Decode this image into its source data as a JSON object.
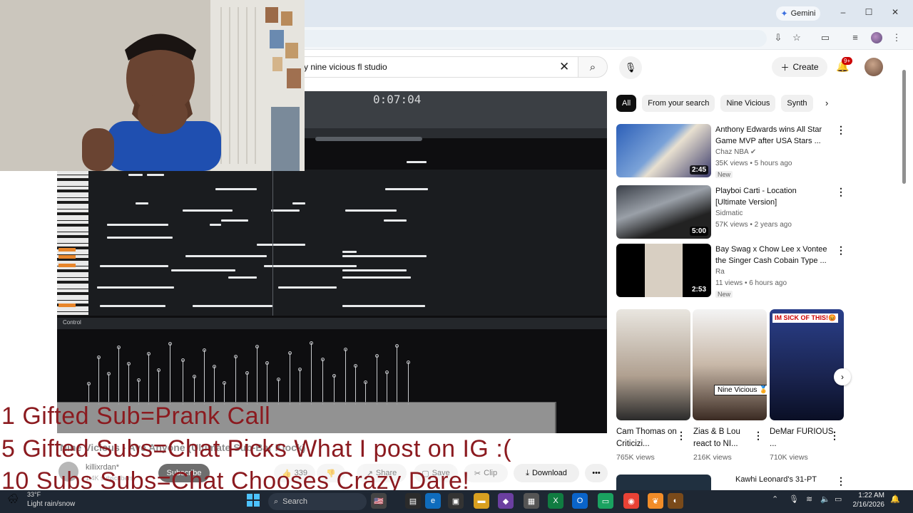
{
  "browser": {
    "gemini_label": "Gemini",
    "window_controls": [
      "–",
      "☐",
      "✕"
    ]
  },
  "youtube": {
    "search_value": "y nine vicious fl studio",
    "create_label": "Create",
    "notif_badge": "9+",
    "chips": [
      "All",
      "From your search",
      "Nine Vicious",
      "Synth"
    ]
  },
  "player": {
    "fl_time": "0:07:04",
    "control_label": "Control"
  },
  "below_player": {
    "video_title": "Nine Vicious - Ave Anyone (Ultimate Sub-Bar Klock)",
    "channel": "killixrdan*",
    "subs": "1.4K subscribers",
    "subscribe": "Subscribe",
    "likes": "339",
    "share": "Share",
    "save": "Save",
    "clip": "Clip",
    "download": "Download"
  },
  "recommendations": [
    {
      "title": "Anthony Edwards wins All Star Game MVP after USA Stars ...",
      "channel": "Chaz NBA",
      "meta": "35K views • 5 hours ago",
      "duration": "2:45",
      "badge": "New"
    },
    {
      "title": "Playboi Carti - Location [Ultimate Version]",
      "channel": "Sidmatic",
      "meta": "57K views • 2 years ago",
      "duration": "5:00",
      "badge": ""
    },
    {
      "title": "Bay Swag x Chow Lee x Vontee the Singer Cash Cobain Type ...",
      "channel": "Ra",
      "meta": "11 views • 6 hours ago",
      "duration": "2:53",
      "badge": "New"
    }
  ],
  "shorts": [
    {
      "title": "Cam Thomas on Criticizi...",
      "views": "765K views"
    },
    {
      "title": "Zias & B Lou react to NI...",
      "views": "216K views",
      "caption": "Nine Vicious 🏅"
    },
    {
      "title": "DeMar FURIOUS ...",
      "views": "710K views",
      "caption": "IM SICK OF THIS!😡"
    }
  ],
  "last_rec_title": "Kawhi Leonard's 31-PT",
  "overlay": {
    "line1": "1 Gifted Sub=Prank Call",
    "line2": "5 Gifted Subs=Chat Picks What I post on IG :(",
    "line3": "10 Subs Subs=Chat Chooses Crazy Dare!"
  },
  "taskbar": {
    "temp": "33°F",
    "weather": "Light rain/snow",
    "search": "Search",
    "time": "1:22 AM",
    "date": "2/16/2026"
  },
  "colors": {
    "overlay_red": "#8b1a1f",
    "yt_red": "#cc0000",
    "fl_orange": "#e8852a"
  }
}
